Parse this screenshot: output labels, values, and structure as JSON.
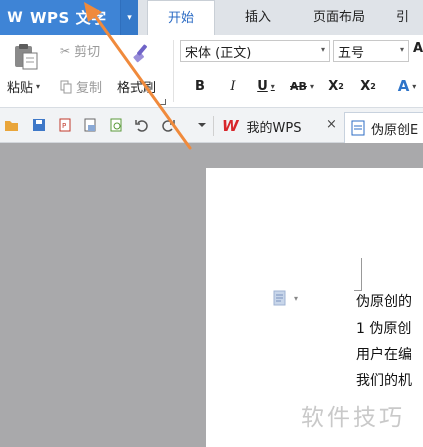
{
  "app_menu": {
    "logo": "W",
    "title": "WPS 文字",
    "dropdown": "▾"
  },
  "tabs": {
    "home": "开始",
    "insert": "插入",
    "page_layout": "页面布局",
    "references": "引"
  },
  "clipboard": {
    "paste": "粘贴",
    "cut": "剪切",
    "copy": "复制",
    "format_painter": "格式刷"
  },
  "font": {
    "family": "宋体 (正文)",
    "size": "五号",
    "grow": "A"
  },
  "format": {
    "bold": "B",
    "italic": "I",
    "underline": "U",
    "strike": "AB",
    "superscript": "X",
    "sup_mark": "2",
    "subscript": "X",
    "sub_mark": "2",
    "font_color": "A"
  },
  "doc_tabs": {
    "my_wps": "我的WPS",
    "my_wps_close": "×",
    "document": "伪原创E"
  },
  "document": {
    "lines": [
      "伪原创的",
      "1 伪原创",
      "用户在编",
      "我们的机"
    ],
    "watermark": "软件技巧"
  },
  "colors": {
    "accent": "#3e84d6",
    "arrow": "#f08a3c",
    "wps_red": "#d8262b"
  }
}
